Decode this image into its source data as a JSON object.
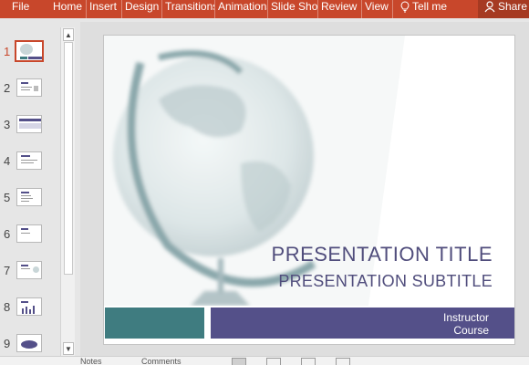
{
  "ribbon": {
    "tabs": [
      "File",
      "Home",
      "Insert",
      "Design",
      "Transitions",
      "Animations",
      "Slide Show",
      "Review",
      "View"
    ],
    "tell_me": "Tell me",
    "share": "Share"
  },
  "thumbnails": {
    "numbers": [
      "1",
      "2",
      "3",
      "4",
      "5",
      "6",
      "7",
      "8",
      "9"
    ],
    "selected": "1"
  },
  "slide": {
    "title": "PRESENTATION TITLE",
    "subtitle": "PRESENTATION SUBTITLE",
    "instructor": "Instructor",
    "course": "Course"
  },
  "statusbar": {
    "notes": "Notes",
    "comments": "Comments"
  },
  "colors": {
    "ribbon": "#c8472b",
    "slide_text": "#504d7c",
    "teal_band": "#3f7c80",
    "purple_band": "#545089"
  }
}
